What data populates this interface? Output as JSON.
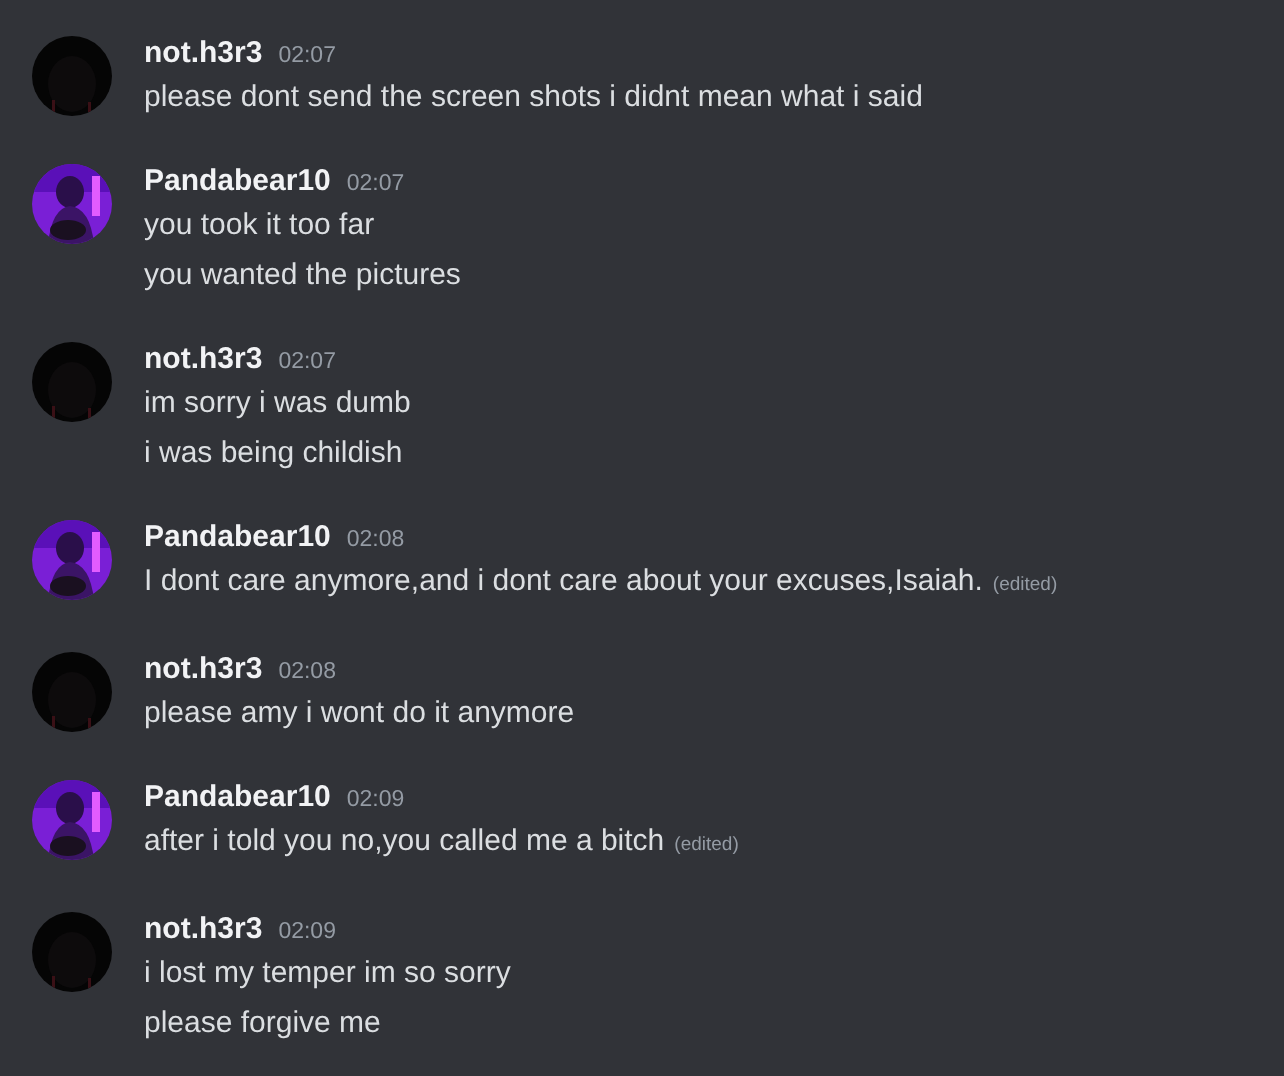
{
  "messages": [
    {
      "author": "not.h3r3",
      "avatar": {
        "kind": "dark"
      },
      "time": "02:07",
      "lines": [
        {
          "text": "please dont send the screen shots i didnt mean what i said"
        }
      ]
    },
    {
      "author": "Pandabear10",
      "avatar": {
        "kind": "purple"
      },
      "time": "02:07",
      "lines": [
        {
          "text": "you took it too far"
        },
        {
          "text": "you wanted the pictures"
        }
      ]
    },
    {
      "author": "not.h3r3",
      "avatar": {
        "kind": "dark"
      },
      "time": "02:07",
      "lines": [
        {
          "text": "im sorry i was dumb"
        },
        {
          "text": "i was being childish"
        }
      ]
    },
    {
      "author": "Pandabear10",
      "avatar": {
        "kind": "purple"
      },
      "time": "02:08",
      "lines": [
        {
          "text": "I dont care anymore,and i dont care about your excuses,Isaiah.",
          "edited_label": "(edited)"
        }
      ]
    },
    {
      "author": "not.h3r3",
      "avatar": {
        "kind": "dark"
      },
      "time": "02:08",
      "lines": [
        {
          "text": "please amy i wont do it anymore"
        }
      ]
    },
    {
      "author": "Pandabear10",
      "avatar": {
        "kind": "purple"
      },
      "time": "02:09",
      "lines": [
        {
          "text": "after i told you no,you called me a bitch",
          "edited_label": "(edited)"
        }
      ]
    },
    {
      "author": "not.h3r3",
      "avatar": {
        "kind": "dark"
      },
      "time": "02:09",
      "lines": [
        {
          "text": "i lost my temper im so sorry"
        },
        {
          "text": "please forgive me"
        }
      ]
    }
  ]
}
